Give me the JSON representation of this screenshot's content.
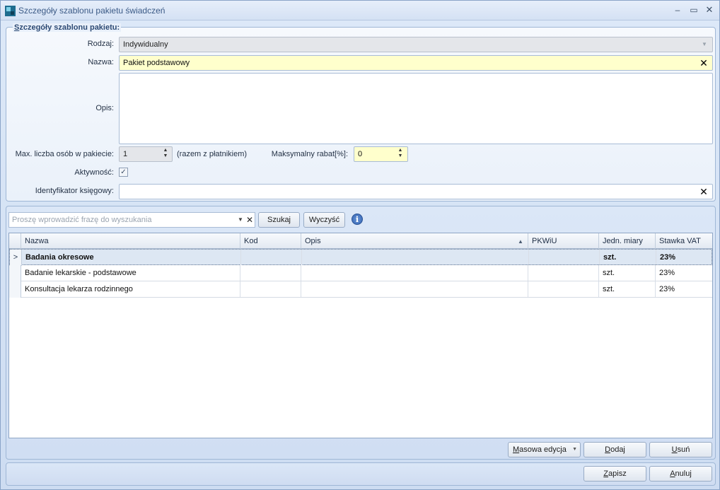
{
  "window": {
    "title": "Szczegóły szablonu pakietu świadczeń",
    "minimize": "–",
    "maximize": "▭",
    "close": "✕"
  },
  "details": {
    "legend_first": "S",
    "legend_rest": "zczegóły szablonu pakietu:",
    "type_label": "Rodzaj:",
    "type_value": "Indywidualny",
    "name_label": "Nazwa:",
    "name_value": "Pakiet podstawowy",
    "description_label": "Opis:",
    "description_value": "",
    "max_persons_label": "Max. liczba osób w pakiecie:",
    "max_persons_value": "1",
    "max_persons_note": "(razem z płatnikiem)",
    "max_discount_label": "Maksymalny rabat[%]:",
    "max_discount_value": "0",
    "active_label": "Aktywność:",
    "active_checked": true,
    "accounting_id_label": "Identyfikator księgowy:",
    "accounting_id_value": ""
  },
  "search": {
    "placeholder": "Proszę wprowadzić frazę do wyszukania",
    "search_button": "Szukaj",
    "clear_button": "Wyczyść"
  },
  "table": {
    "columns": [
      "Nazwa",
      "Kod",
      "Opis",
      "PKWiU",
      "Jedn. miary",
      "Stawka VAT"
    ],
    "sorted_column": "Opis",
    "rows": [
      {
        "nazwa": "Badania okresowe",
        "kod": "",
        "opis": "",
        "pkwiu": "",
        "jm": "szt.",
        "vat": "23%",
        "bold": true,
        "selected": true
      },
      {
        "nazwa": "Badanie lekarskie - podstawowe",
        "kod": "",
        "opis": "",
        "pkwiu": "",
        "jm": "szt.",
        "vat": "23%",
        "bold": false,
        "selected": false
      },
      {
        "nazwa": "Konsultacja lekarza rodzinnego",
        "kod": "",
        "opis": "",
        "pkwiu": "",
        "jm": "szt.",
        "vat": "23%",
        "bold": false,
        "selected": false
      }
    ]
  },
  "actions": {
    "mass_edit_first": "M",
    "mass_edit_rest": "asowa edycja",
    "add_first": "D",
    "add_rest": "odaj",
    "remove_first": "U",
    "remove_rest": "suń"
  },
  "footer": {
    "save_first": "Z",
    "save_rest": "apisz",
    "cancel_first": "A",
    "cancel_rest": "nuluj"
  },
  "colors": {
    "highlight_field": "#ffffcc",
    "selected_row": "#dde7f3",
    "title_text": "#3b5a86"
  }
}
